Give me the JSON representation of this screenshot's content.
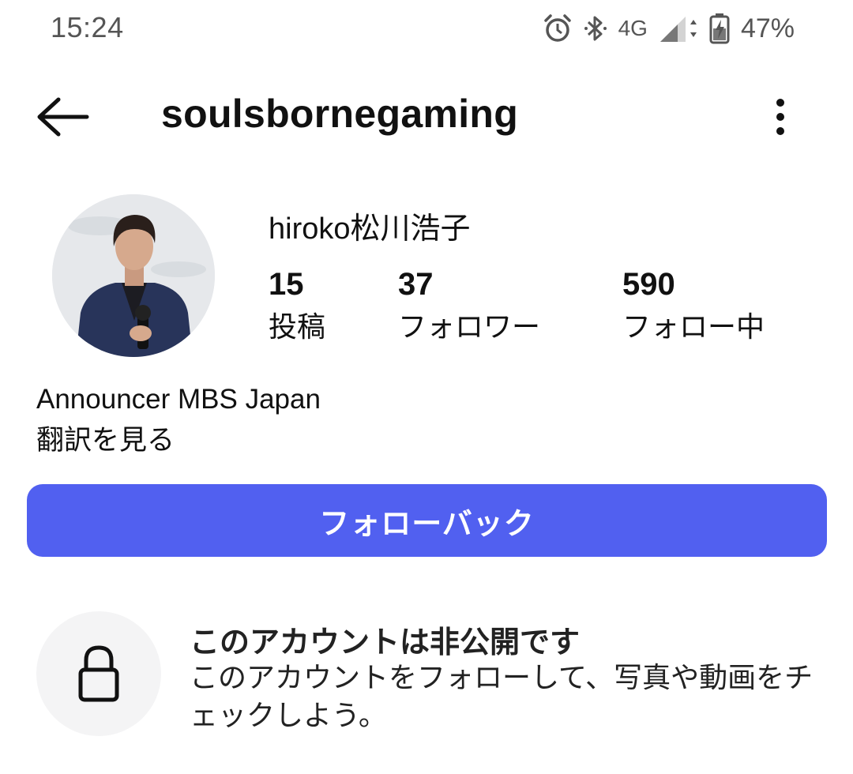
{
  "status_bar": {
    "time": "15:24",
    "network": "4G",
    "battery": "47%",
    "icons": [
      "alarm-icon",
      "bluetooth-icon",
      "signal-icon",
      "battery-charging-icon"
    ]
  },
  "header": {
    "username": "soulsbornegaming",
    "back_icon": "arrow-left-icon",
    "more_icon": "more-vertical-icon"
  },
  "profile": {
    "display_name": "hiroko松川浩子",
    "stats": [
      {
        "value": "15",
        "label": "投稿"
      },
      {
        "value": "37",
        "label": "フォロワー"
      },
      {
        "value": "590",
        "label": "フォロー中"
      }
    ],
    "bio": "Announcer MBS Japan",
    "translate_label": "翻訳を見る"
  },
  "actions": {
    "follow_back_label": "フォローバック"
  },
  "private_notice": {
    "title": "このアカウントは非公開です",
    "description": "このアカウントをフォローして、写真や動画をチェックしよう。",
    "icon": "lock-icon"
  },
  "colors": {
    "accent": "#5160f0",
    "status_text": "#555555",
    "text": "#111111"
  }
}
